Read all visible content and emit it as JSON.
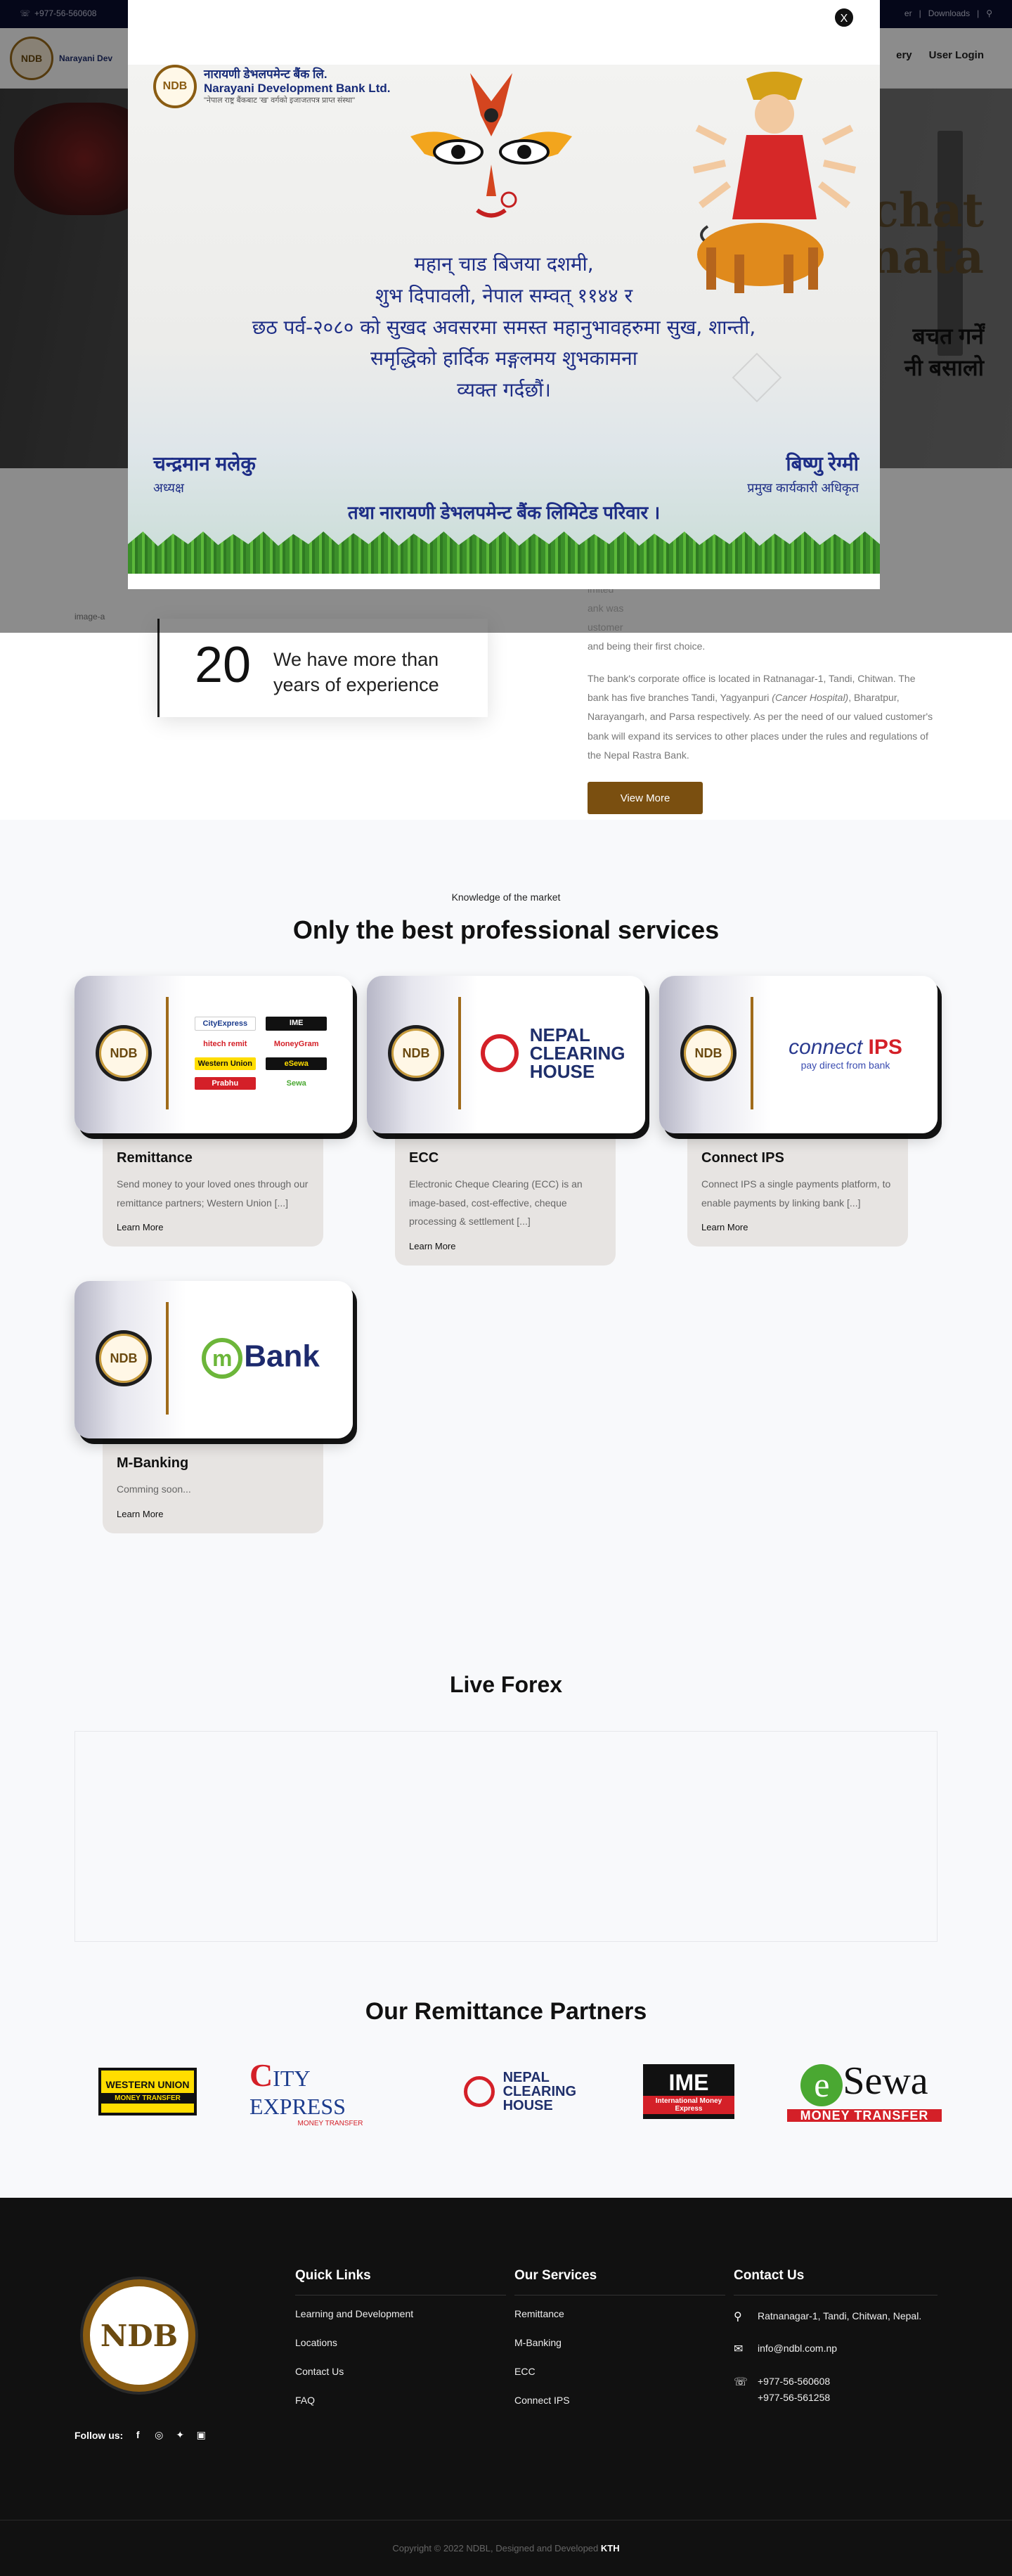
{
  "topbar": {
    "phone": "+977-56-560608",
    "links": [
      "er",
      "Downloads"
    ]
  },
  "header": {
    "logo_text": "Narayani Dev",
    "logo_seal": "NDB",
    "nav": [
      "ery",
      "User Login"
    ]
  },
  "hero": {
    "right_text": "chat nata",
    "right_np_1": "बचत गर्नें",
    "right_np_2": "नी बसालो"
  },
  "about": {
    "exp_number": "20",
    "exp_text": "We have more than years of experience",
    "img_alt": "image-a",
    "faded_fragments": [
      "nsactions",
      "nancial",
      "imited",
      "ank was",
      "ustomer"
    ],
    "para1_end": "and being their first choice.",
    "para2": "The bank's corporate office is located in Ratnanagar-1, Tandi, Chitwan. The bank has five branches Tandi, Yagyanpuri",
    "para2_italic": "(Cancer Hospital)",
    "para2_rest": ", Bharatpur, Narayangarh, and Parsa respectively. As per the need of our valued customer's bank will expand its services to other places under the rules and regulations of the Nepal Rastra Bank.",
    "view_more": "View More"
  },
  "services": {
    "kicker": "Knowledge of the market",
    "title": "Only the best professional services",
    "items": [
      {
        "name": "Remittance",
        "desc": "Send money to your loved ones through our remittance partners; Western Union [...]",
        "learn": "Learn More",
        "brand": "remittance-logos"
      },
      {
        "name": "ECC",
        "desc": "Electronic Cheque Clearing (ECC) is an image-based, cost-effective, cheque processing & settlement [...]",
        "learn": "Learn More",
        "brand": "nepal-clearing-house"
      },
      {
        "name": "Connect IPS",
        "desc": "Connect IPS a single payments platform, to enable payments by linking bank [...]",
        "learn": "Learn More",
        "brand": "connect-ips"
      },
      {
        "name": "M-Banking",
        "desc": "Comming soon...",
        "learn": "Learn More",
        "brand": "mbank"
      }
    ],
    "seal_text": "NDB",
    "remit_logos": [
      "CityExpress",
      "IME",
      "hitech remit",
      "MoneyGram",
      "Western Union",
      "eSewa",
      "Prabhu",
      "Sewa"
    ],
    "ncl_text": [
      "NEPAL",
      "CLEARING",
      "HOUSE"
    ],
    "ips_text": {
      "connect": "connect",
      "ips": "IPS",
      "tagline": "pay direct from bank"
    },
    "mbank_text": {
      "m": "m",
      "bank": "Bank"
    }
  },
  "forex": {
    "title": "Live Forex"
  },
  "partners": {
    "title": "Our Remittance Partners",
    "wu": {
      "name": "WESTERN UNION",
      "sub": "MONEY TRANSFER"
    },
    "city": {
      "c": "C",
      "name": "ITY EXPRESS",
      "sub": "MONEY TRANSFER"
    },
    "ncl": [
      "NEPAL",
      "CLEARING",
      "HOUSE"
    ],
    "ime": {
      "name": "IME",
      "sub": "International Money Express"
    },
    "esewa": {
      "e": "e",
      "name": "Sewa",
      "sub": "MONEY TRANSFER"
    }
  },
  "footer": {
    "seal": "NDB",
    "follow": "Follow us:",
    "social_icons": [
      "facebook-icon",
      "instagram-icon",
      "twitter-icon",
      "linkedin-icon"
    ],
    "quick_links": {
      "title": "Quick Links",
      "items": [
        "Learning and Development",
        "Locations",
        "Contact Us",
        "FAQ"
      ]
    },
    "our_services": {
      "title": "Our Services",
      "items": [
        "Remittance",
        "M-Banking",
        "ECC",
        "Connect IPS"
      ]
    },
    "contact": {
      "title": "Contact Us",
      "address": "Ratnanagar-1, Tandi, Chitwan, Nepal.",
      "email": "info@ndbl.com.np",
      "phone1": "+977-56-560608",
      "phone2": "+977-56-561258"
    },
    "copyright_prefix": "Copyright © 2022 NDBL, Designed and Developed ",
    "copyright_brand": "KTH"
  },
  "modal": {
    "close": "X",
    "bank_np": "नारायणी डेभलपमेन्ट बैंक लि.",
    "bank_en": "Narayani Development Bank Ltd.",
    "bank_tag": "\"नेपाल राष्ट्र बैंकबाट 'ख' वर्गको इजाजतपत्र प्राप्त संस्था\"",
    "greet_1": "महान् चाड बिजया दशमी,",
    "greet_2": "शुभ दिपावली, नेपाल सम्वत् ११४४ र",
    "greet_3": "छठ पर्व-२०८० को सुखद अवसरमा समस्त महानुभावहरुमा सुख, शान्ती,",
    "greet_4": "समृद्धिको हार्दिक मङ्गलमय शुभकामना",
    "greet_5": "व्यक्त गर्दछौं।",
    "sig_left_name": "चन्द्रमान मलेकु",
    "sig_left_title": "अध्यक्ष",
    "sig_right_name": "बिष्णु रेग्मी",
    "sig_right_title": "प्रमुख कार्यकारी अधिकृत",
    "family": "तथा नारायणी डेभलपमेन्ट बैंक लिमिटेड परिवार ।"
  }
}
